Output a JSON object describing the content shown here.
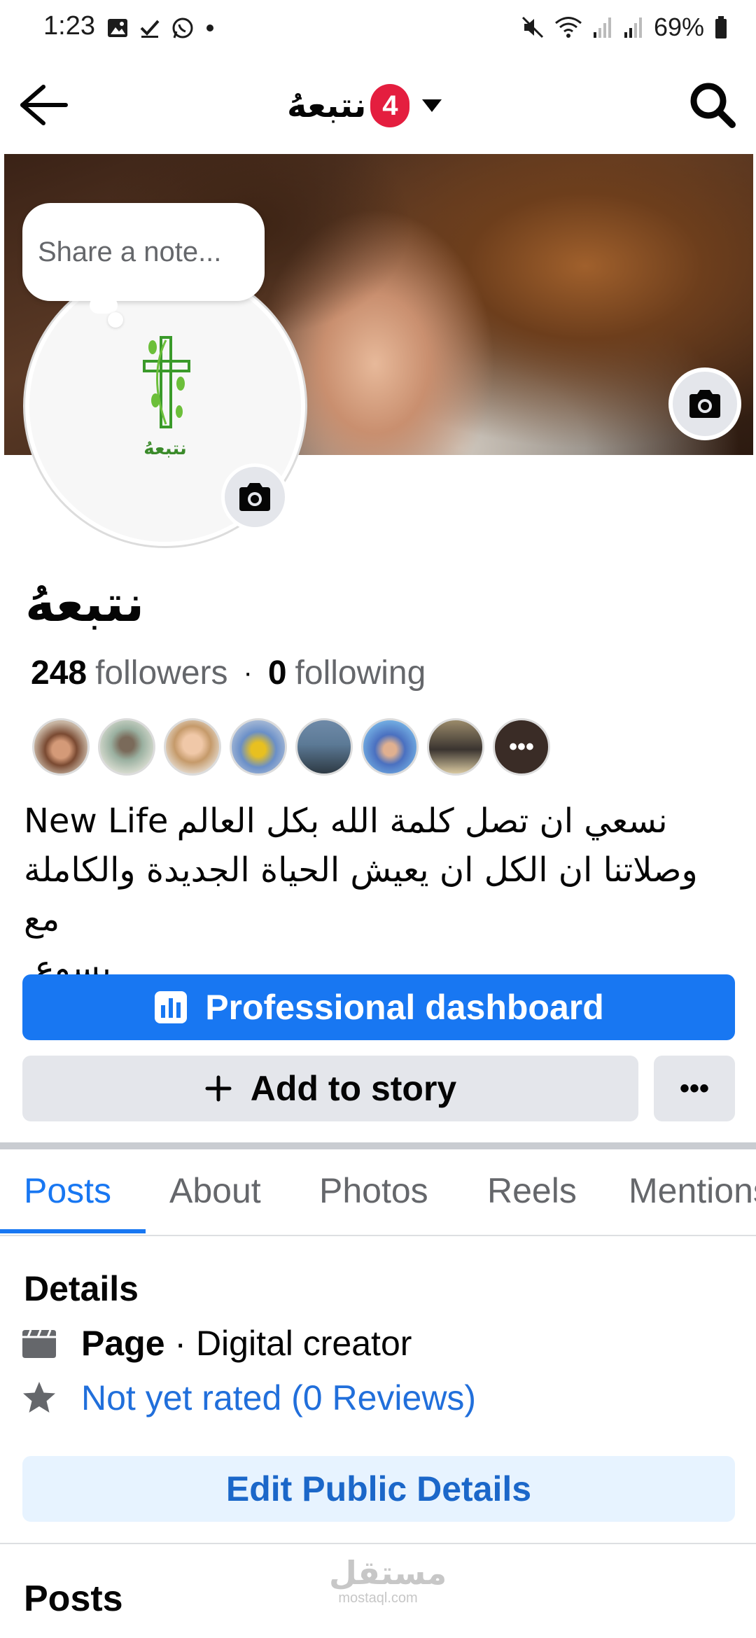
{
  "status_bar": {
    "time": "1:23",
    "battery": "69%",
    "left_icons": [
      "gallery-icon",
      "checkmark-icon",
      "whatsapp-icon",
      "dot-icon"
    ],
    "right_icons": [
      "mute-icon",
      "wifi-icon",
      "signal-icon",
      "signal-icon",
      "battery-icon"
    ]
  },
  "nav": {
    "title": "نتبعهُ",
    "badge": "4",
    "icons": [
      "back-arrow-icon",
      "caret-down-icon",
      "search-icon"
    ]
  },
  "cover": {
    "note_placeholder": "Share a note...",
    "avatar_logo_text": "نتبعهُ"
  },
  "profile": {
    "name": "نتبعهُ",
    "followers_count": "248",
    "followers_label": "followers",
    "following_count": "0",
    "following_label": "following",
    "bio_line1_en": "New Life",
    "bio_line1_ar": "نسعي ان تصل كلمة الله بكل العالم",
    "bio_line2": "وصلاتنا ان الكل ان يعيش الحياة الجديدة والكاملة مع",
    "bio_line3": "يسوع."
  },
  "followers_avatars": [
    "follower-1",
    "follower-2",
    "follower-3",
    "follower-4",
    "follower-5",
    "follower-6",
    "follower-7"
  ],
  "followers_more": "•••",
  "actions": {
    "dashboard": "Professional dashboard",
    "add_story": "Add to story",
    "more": "•••"
  },
  "tabs": [
    {
      "label": "Posts",
      "active": true
    },
    {
      "label": "About",
      "active": false
    },
    {
      "label": "Photos",
      "active": false
    },
    {
      "label": "Reels",
      "active": false
    },
    {
      "label": "Mentions",
      "active": false
    }
  ],
  "details": {
    "title": "Details",
    "page_type_bold": "Page",
    "page_type_rest": " · Digital creator",
    "rating": "Not yet rated (0 Reviews)",
    "edit_button": "Edit Public Details"
  },
  "posts_heading": "Posts",
  "watermark": {
    "arabic": "مستقل",
    "latin": "mostaql.com"
  },
  "colors": {
    "accent": "#1877f2",
    "badge": "#e41e3f",
    "link": "#216fdb"
  }
}
